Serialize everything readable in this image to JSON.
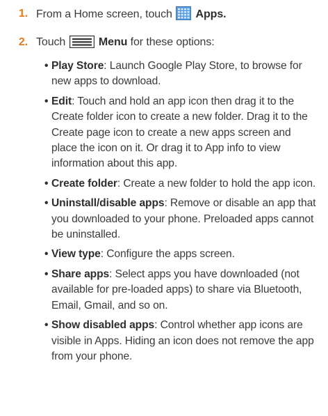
{
  "steps": [
    {
      "number": "1.",
      "prefix": "From a Home screen, touch",
      "label": "Apps",
      "suffix": ".",
      "icon": "apps-grid-icon"
    },
    {
      "number": "2.",
      "prefix": "Touch",
      "label": "Menu",
      "suffix": " for these options:",
      "icon": "menu-icon"
    }
  ],
  "options": [
    {
      "term": "Play Store",
      "desc": ": Launch Google Play Store, to browse for new apps to download."
    },
    {
      "term": "Edit",
      "desc": ": Touch and hold an app icon then drag it to the Create folder icon to create a new folder. Drag it to the Create page icon to create a new apps screen and place the icon on it. Or drag it to App info to view information about this app."
    },
    {
      "term": "Create folder",
      "desc": ": Create a new folder to hold the app icon."
    },
    {
      "term": "Uninstall/disable apps",
      "desc": ": Remove or disable an app that you downloaded to your phone. Preloaded apps cannot be uninstalled."
    },
    {
      "term": "View type",
      "desc": ": Configure the apps screen."
    },
    {
      "term": "Share apps",
      "desc": ": Select apps you have downloaded (not available for pre-loaded apps) to share via Bluetooth, Email, Gmail, and so on."
    },
    {
      "term": "Show disabled apps",
      "desc": ": Control whether app icons are visible in Apps. Hiding an icon does not remove the app from your phone."
    }
  ],
  "colors": {
    "step_number": "#e07a1f",
    "apps_icon": "#4a90d9",
    "text": "#3a3a3a"
  }
}
